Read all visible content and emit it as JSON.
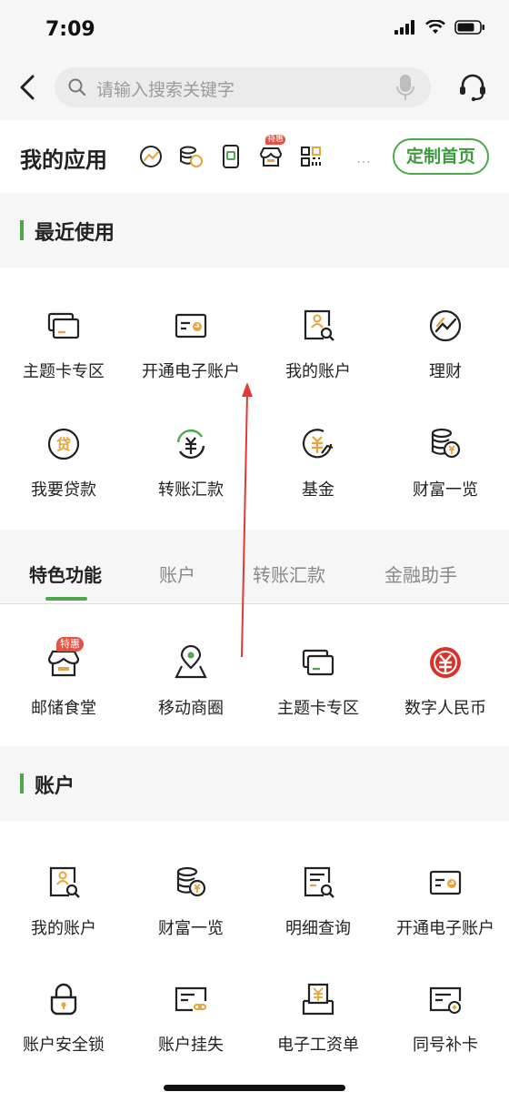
{
  "status": {
    "time": "7:09"
  },
  "search": {
    "placeholder": "请输入搜索关键字"
  },
  "my_apps": {
    "title": "我的应用",
    "icons": [
      "wealth-chart-icon",
      "coins-icon",
      "phone-scan-icon",
      "store-discount-icon",
      "qrcode-icon"
    ],
    "badge": "特惠",
    "more": "…",
    "customize_label": "定制首页"
  },
  "recent": {
    "title": "最近使用",
    "items": [
      {
        "label": "主题卡专区",
        "icon": "cards-icon"
      },
      {
        "label": "开通电子账户",
        "icon": "e-card-icon"
      },
      {
        "label": "我的账户",
        "icon": "account-search-icon"
      },
      {
        "label": "理财",
        "icon": "finance-chart-icon"
      },
      {
        "label": "我要贷款",
        "icon": "loan-icon"
      },
      {
        "label": "转账汇款",
        "icon": "transfer-yen-icon"
      },
      {
        "label": "基金",
        "icon": "fund-icon"
      },
      {
        "label": "财富一览",
        "icon": "wealth-coins-icon"
      }
    ]
  },
  "tabs": [
    "特色功能",
    "账户",
    "转账汇款",
    "金融助手"
  ],
  "features": {
    "badge": "特惠",
    "items": [
      {
        "label": "邮储食堂",
        "icon": "canteen-store-icon"
      },
      {
        "label": "移动商圈",
        "icon": "map-pin-icon"
      },
      {
        "label": "主题卡专区",
        "icon": "cards-icon"
      },
      {
        "label": "数字人民币",
        "icon": "digital-rmb-icon"
      }
    ]
  },
  "account": {
    "title": "账户",
    "items": [
      {
        "label": "我的账户",
        "icon": "account-search-icon"
      },
      {
        "label": "财富一览",
        "icon": "wealth-coins-icon"
      },
      {
        "label": "明细查询",
        "icon": "detail-query-icon"
      },
      {
        "label": "开通电子账户",
        "icon": "e-card-icon"
      },
      {
        "label": "账户安全锁",
        "icon": "lock-icon"
      },
      {
        "label": "账户挂失",
        "icon": "card-loss-icon"
      },
      {
        "label": "电子工资单",
        "icon": "payslip-icon"
      },
      {
        "label": "同号补卡",
        "icon": "card-reissue-icon"
      }
    ]
  },
  "colors": {
    "accent": "#4ca84a",
    "icon_orange": "#e8a33a",
    "red": "#d9322b"
  }
}
